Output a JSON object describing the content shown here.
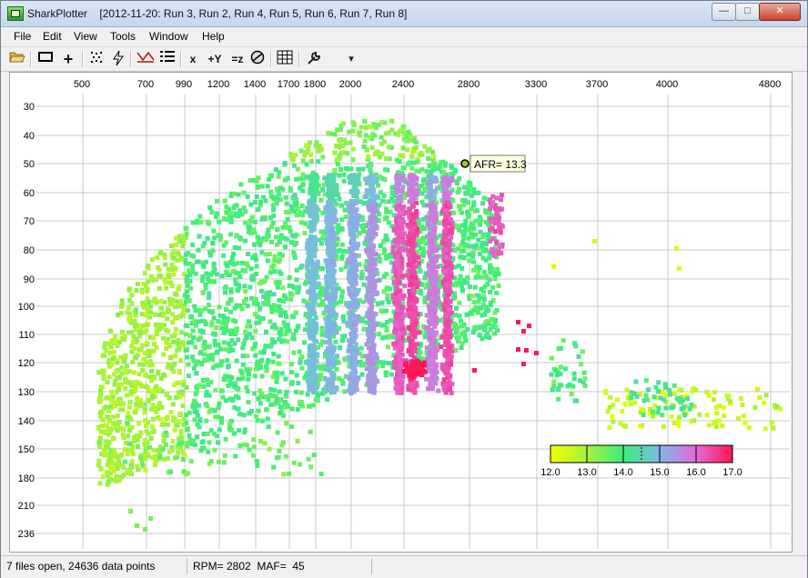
{
  "window": {
    "title": "SharkPlotter    [2012-11-20: Run 3, Run 2, Run 4, Run 5, Run 6, Run 7, Run 8]",
    "minimize_glyph": "—",
    "maximize_glyph": "□",
    "close_glyph": "✕"
  },
  "menu": [
    "File",
    "Edit",
    "View",
    "Tools",
    "Window",
    "Help"
  ],
  "toolbar": {
    "open_icon": "folder-open-icon",
    "rect_label": "▭",
    "crosshair_label": "+",
    "scatter_label": "∷",
    "lightning_label": "ϟ",
    "xy_label": "⨯",
    "list_label": "☰",
    "x_label": "x",
    "y_label": "+Y",
    "z_label": "=z",
    "filter_label": "⊘",
    "grid_label": "▦",
    "tools_label": "⚒",
    "dropdown_label": "▾"
  },
  "chart_data": {
    "type": "scatter",
    "x_ticks": [
      "500",
      "700",
      "990",
      "1200",
      "1400",
      "1700",
      "1800",
      "2000",
      "2400",
      "2800",
      "3300",
      "3700",
      "4000",
      "4800"
    ],
    "y_ticks": [
      "30",
      "40",
      "50",
      "60",
      "70",
      "80",
      "90",
      "100",
      "110",
      "120",
      "130",
      "140",
      "150",
      "180",
      "210",
      "236"
    ],
    "x_variable": "RPM",
    "y_variable": "MAF",
    "color_variable": "AFR",
    "colorbar": {
      "ticks": [
        "12.0",
        "13.0",
        "14.0",
        "15.0",
        "16.0",
        "17.0"
      ],
      "colors": [
        "#f2ff00",
        "#a6f23a",
        "#39ee7e",
        "#7fb7e6",
        "#e36ad9",
        "#ff1452"
      ]
    },
    "tooltip": "AFR= 13.3",
    "cursor": {
      "rpm": 2802,
      "maf": 45,
      "afr": 13.3
    },
    "point_count": 24636
  },
  "status": {
    "files": "7 files open, 24636 data points",
    "cursor": "RPM= 2802  MAF=  45"
  }
}
